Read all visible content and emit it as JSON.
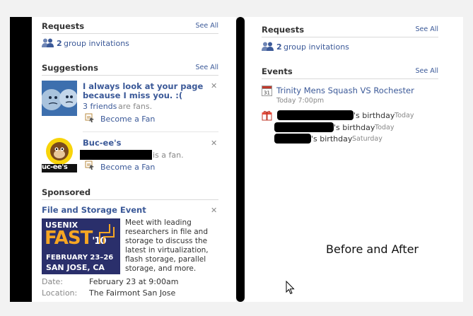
{
  "left": {
    "requests": {
      "title": "Requests",
      "see_all": "See All",
      "count": "2",
      "text": "group invitations"
    },
    "suggestions": {
      "title": "Suggestions",
      "see_all": "See All",
      "items": [
        {
          "title_line1": "I always look at your page",
          "title_line2": "because I miss you. :(",
          "fans_count": "3 friends",
          "fans_suffix": "are fans.",
          "action": "Become a Fan"
        },
        {
          "title": "Buc-ee's",
          "fans_suffix": "is a fan.",
          "action": "Become a Fan",
          "logo_text": "uc-ee's"
        }
      ]
    },
    "sponsored": {
      "title": "Sponsored",
      "ad_title": "File and Storage Event",
      "ad_image": {
        "brand": "USENIX",
        "event": "FAST",
        "year": "'10",
        "dates": "FEBRUARY 23–26",
        "city": "SAN JOSE, CA"
      },
      "ad_body": [
        "Meet with leading",
        "researchers in file and",
        "storage to discuss the",
        "latest in virtualization,",
        "flash storage, parallel",
        "storage, and more."
      ],
      "date_label": "Date:",
      "date_value": "February 23 at 9:00am",
      "location_label": "Location:",
      "location_value": "The Fairmont San Jose"
    }
  },
  "right": {
    "requests": {
      "title": "Requests",
      "see_all": "See All",
      "count": "2",
      "text": "group invitations"
    },
    "events": {
      "title": "Events",
      "see_all": "See All",
      "calendar_day": "31",
      "event_title": "Trinity Mens Squash VS Rochester",
      "event_time": "Today 7:00pm",
      "birthdays": [
        {
          "suffix": "'s birthday",
          "when": "Today"
        },
        {
          "suffix": "'s birthday",
          "when": "Today"
        },
        {
          "suffix": "'s birthday",
          "when": "Saturday"
        }
      ]
    }
  },
  "caption": "Before and After",
  "colors": {
    "link": "#3b5998",
    "divider": "#d9d9d9",
    "muted": "#888888"
  }
}
